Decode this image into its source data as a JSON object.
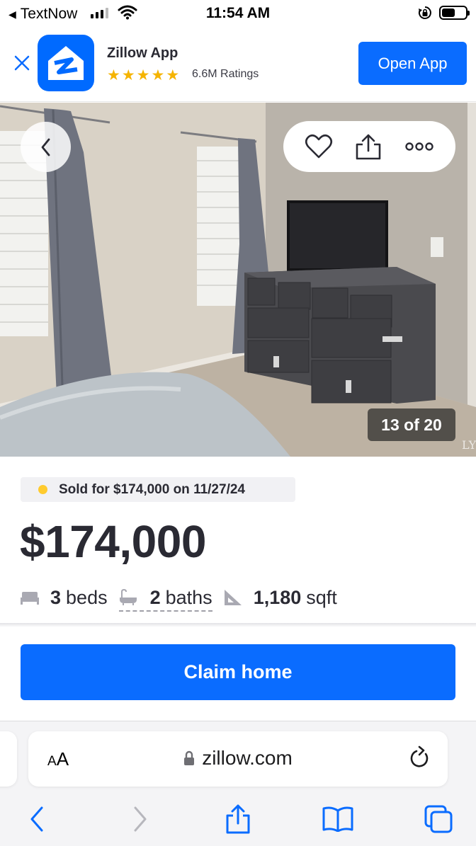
{
  "status_bar": {
    "back_app": "TextNow",
    "time": "11:54 AM",
    "battery_level": 0.55
  },
  "banner": {
    "app_name": "Zillow App",
    "stars": 5,
    "ratings": "6.6M Ratings",
    "open_label": "Open App",
    "icons": {
      "close": "close-icon",
      "app": "zillow-logo-icon"
    }
  },
  "photo": {
    "counter": "13 of 20",
    "watermark": "LY",
    "icons": {
      "back": "chevron-left-icon",
      "save": "heart-icon",
      "share": "share-icon",
      "more": "more-icon"
    }
  },
  "listing": {
    "sold_text": "Sold for $174,000 on 11/27/24",
    "price": "$174,000",
    "beds_value": "3",
    "beds_label": "beds",
    "baths_value": "2",
    "baths_label": "baths",
    "sqft_value": "1,180",
    "sqft_label": "sqft"
  },
  "cta": {
    "claim_label": "Claim home"
  },
  "browser": {
    "aa_small": "A",
    "aa_big": "A",
    "domain": "zillow.com",
    "icons": [
      "chevron-left-icon",
      "chevron-right-icon",
      "share-icon",
      "book-icon",
      "tabs-icon"
    ]
  },
  "colors": {
    "brand_blue": "#0a6cff",
    "sold_dot": "#ffcb2e",
    "text": "#2a2a33"
  }
}
